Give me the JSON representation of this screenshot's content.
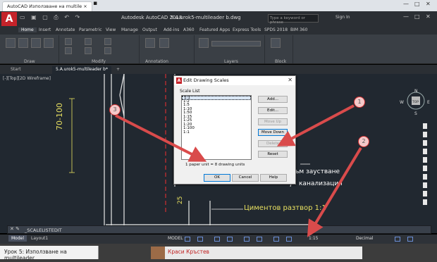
{
  "browser": {
    "tab_title": "AutoCAD Използване на multile",
    "tab_close": "×",
    "new_tab": "▪",
    "controls": [
      "—",
      "□",
      "✕"
    ]
  },
  "app": {
    "logo": "A",
    "title": "Autodesk AutoCAD 2018",
    "file": "5.A.urok5-multileader b.dwg",
    "search_placeholder": "Type a keyword or phrase",
    "signin": "Sign In",
    "window_controls": [
      "—",
      "□",
      "✕"
    ]
  },
  "ribbon": {
    "tabs": [
      "Home",
      "Insert",
      "Annotate",
      "Parametric",
      "View",
      "Manage",
      "Output",
      "Add-ins",
      "A360",
      "Featured Apps",
      "Express Tools",
      "SPDS 2018",
      "BIM 360"
    ],
    "active_tab": "Home",
    "panels": [
      "Draw",
      "Modify",
      "Annotation",
      "Layers",
      "Block"
    ]
  },
  "doc_tabs": {
    "start": "Start",
    "file": "5.A.urok5-multileader b*",
    "add": "+"
  },
  "viewport": {
    "label": "[-][Top][2D Wireframe]",
    "dimension_text": "70-100",
    "dimension_small": "25",
    "text1": "ъм заустване",
    "text2": "канализация",
    "text3": "Циментов разтвор 1:1",
    "viewcube_n": "N",
    "viewcube_s": "S",
    "viewcube_w": "W",
    "viewcube_e": "E",
    "viewcube_top": "TOP"
  },
  "command": {
    "text": "_SCALELISTEDIT"
  },
  "statusbar": {
    "model_tab": "Model",
    "layout_tab": "Layout1",
    "model_label": "MODEL",
    "scale": "1:15",
    "units": "Decimal"
  },
  "dialog": {
    "title": "Edit Drawing Scales",
    "group_label": "Scale List",
    "scales": [
      "1:1",
      "1:2",
      "1:5",
      "1:10",
      "1:50",
      "1:15",
      "1:25",
      "1:20",
      "1:100",
      "1:1"
    ],
    "selected_index": 0,
    "buttons": {
      "add": "Add...",
      "edit": "Edit...",
      "move_up": "Move Up",
      "move_down": "Move Down",
      "delete": "Delete",
      "reset": "Reset"
    },
    "paper_text": "1 paper unit = 8 drawing units",
    "ok": "OK",
    "cancel": "Cancel",
    "help": "Help"
  },
  "annotations": {
    "badge1": "1",
    "badge2": "2",
    "badge3": "3",
    "arrow_color": "#d94b4b"
  },
  "webinar": {
    "lesson_label": "Урок 5: Използване на multileader",
    "presenter": "Краси Кръстев"
  }
}
